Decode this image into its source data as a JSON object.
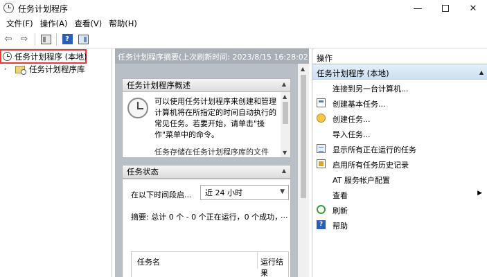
{
  "window": {
    "title": "任务计划程序",
    "minimize_glyph": "—",
    "close_glyph": "✕"
  },
  "menu": [
    "文件(F)",
    "操作(A)",
    "查看(V)",
    "帮助(H)"
  ],
  "toolbar": {
    "back_glyph": "⇦",
    "forward_glyph": "⇨",
    "help_glyph": "?"
  },
  "tree": {
    "root_label": "任务计划程序 (本地)",
    "child_label": "任务计划程序库"
  },
  "middle": {
    "header": "任务计划程序摘要(上次刷新时间: 2023/8/15 16:28:02)",
    "overview": {
      "title": "任务计划程序概述",
      "text": "可以使用任务计划程序来创建和管理计算机将在所指定的时间自动执行的常见任务。若要开始，请单击\"操作\"菜单中的命令。",
      "text2": "任务存储在任务计划程序库的文件"
    },
    "status": {
      "title": "任务状态",
      "period_label": "在以下时间段启...",
      "period_value": "近 24 小时",
      "summary": "摘要: 总计 0 个 - 0 个正在运行，0 个成功，",
      "summary_more": "...",
      "col_name": "任务名",
      "col_result": "运行结果"
    }
  },
  "actions": {
    "header": "操作",
    "section": "任务计划程序 (本地)",
    "items": [
      {
        "label": "连接到另一台计算机...",
        "icon": "none"
      },
      {
        "label": "创建基本任务...",
        "icon": "calendar-icon"
      },
      {
        "label": "创建任务...",
        "icon": "task-icon"
      },
      {
        "label": "导入任务...",
        "icon": "none"
      },
      {
        "label": "显示所有正在运行的任务",
        "icon": "running-list-icon"
      },
      {
        "label": "启用所有任务历史记录",
        "icon": "history-icon"
      },
      {
        "label": "AT 服务帐户配置",
        "icon": "none"
      },
      {
        "label": "查看",
        "icon": "none",
        "submenu": true
      },
      {
        "label": "刷新",
        "icon": "refresh-icon"
      },
      {
        "label": "帮助",
        "icon": "help-icon"
      }
    ]
  },
  "colors": {
    "highlight_border": "#e33a3a",
    "pane_header": "#a9afb6",
    "action_section": "#cfe0f2"
  }
}
